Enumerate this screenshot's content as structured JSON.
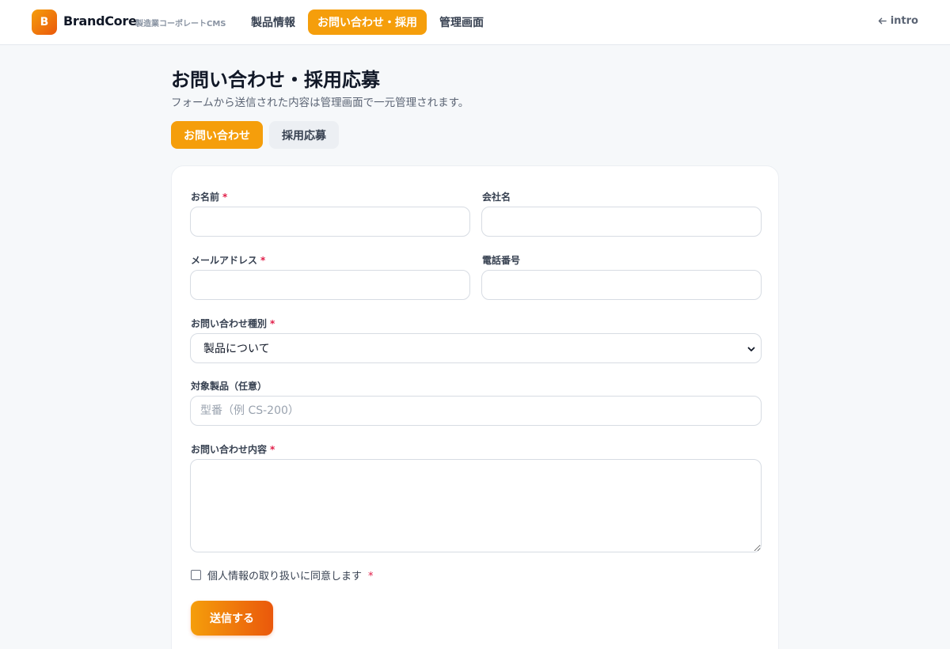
{
  "brand": {
    "logo_letter": "B",
    "name": "BrandCore",
    "subtitle": "製造業コーポレートCMS"
  },
  "nav": {
    "products": "製品情報",
    "contact": "お問い合わせ・採用",
    "admin": "管理画面",
    "active": "contact"
  },
  "back_link": {
    "label": "intro",
    "icon": "arrow-left-icon"
  },
  "page": {
    "title": "お問い合わせ・採用応募",
    "description": "フォームから送信された内容は管理画面で一元管理されます。"
  },
  "tabs": {
    "inquiry": "お問い合わせ",
    "recruit": "採用応募",
    "active": "inquiry"
  },
  "form": {
    "required_mark": "*",
    "name": {
      "label": "お名前",
      "value": "",
      "required": true
    },
    "company": {
      "label": "会社名",
      "value": "",
      "required": false
    },
    "email": {
      "label": "メールアドレス",
      "value": "",
      "required": true
    },
    "phone": {
      "label": "電話番号",
      "value": "",
      "required": false
    },
    "inquiry_type": {
      "label": "お問い合わせ種別",
      "selected": "製品について",
      "required": true
    },
    "product": {
      "label": "対象製品（任意）",
      "placeholder": "型番（例 CS-200）",
      "value": ""
    },
    "message": {
      "label": "お問い合わせ内容",
      "value": "",
      "required": true
    },
    "consent": {
      "label": "個人情報の取り扱いに同意します",
      "checked": false,
      "required": true
    },
    "submit_label": "送信する"
  },
  "colors": {
    "accent": "#f59e0b",
    "accent_dark": "#ea580c",
    "required": "#e11d48"
  }
}
